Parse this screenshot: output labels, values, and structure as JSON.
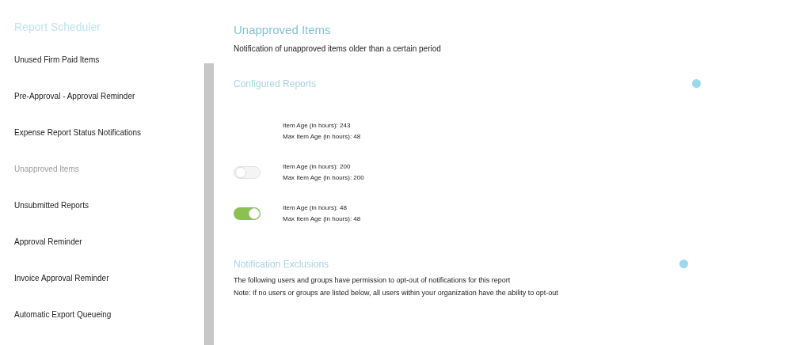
{
  "sidebar": {
    "title": "Report Scheduler",
    "items": [
      {
        "label": "Unused Firm Paid Items",
        "selected": false
      },
      {
        "label": "Pre-Approval - Approval Reminder",
        "selected": false
      },
      {
        "label": "Expense Report Status Notifications",
        "selected": false
      },
      {
        "label": "Unapproved Items",
        "selected": true
      },
      {
        "label": "Unsubmitted Reports",
        "selected": false
      },
      {
        "label": "Approval Reminder",
        "selected": false
      },
      {
        "label": "Invoice Approval Reminder",
        "selected": false
      },
      {
        "label": "Automatic Export Queueing",
        "selected": false
      }
    ]
  },
  "main": {
    "title": "Unapproved Items",
    "description": "Notification of unapproved items older than a certain period",
    "configured_reports": {
      "title": "Configured Reports",
      "rows": [
        {
          "criteria": [
            "Item Age (in hours): 243",
            "Max Item Age (in hours): 48"
          ]
        },
        {
          "on": false,
          "criteria": [
            "Item Age (in hours): 200",
            "Max Item Age (in hours): 200"
          ]
        },
        {
          "on": true,
          "criteria": [
            "Item Age (in hours): 48",
            "Max Item Age (in hours): 48"
          ]
        }
      ]
    },
    "exclusions": {
      "title": "Notification Exclusions",
      "lines": [
        "The following users and groups have permission to opt-out of notifications for this report",
        "Note: If no users or groups are listed below, all users within your organization have the ability to opt-out"
      ]
    }
  }
}
